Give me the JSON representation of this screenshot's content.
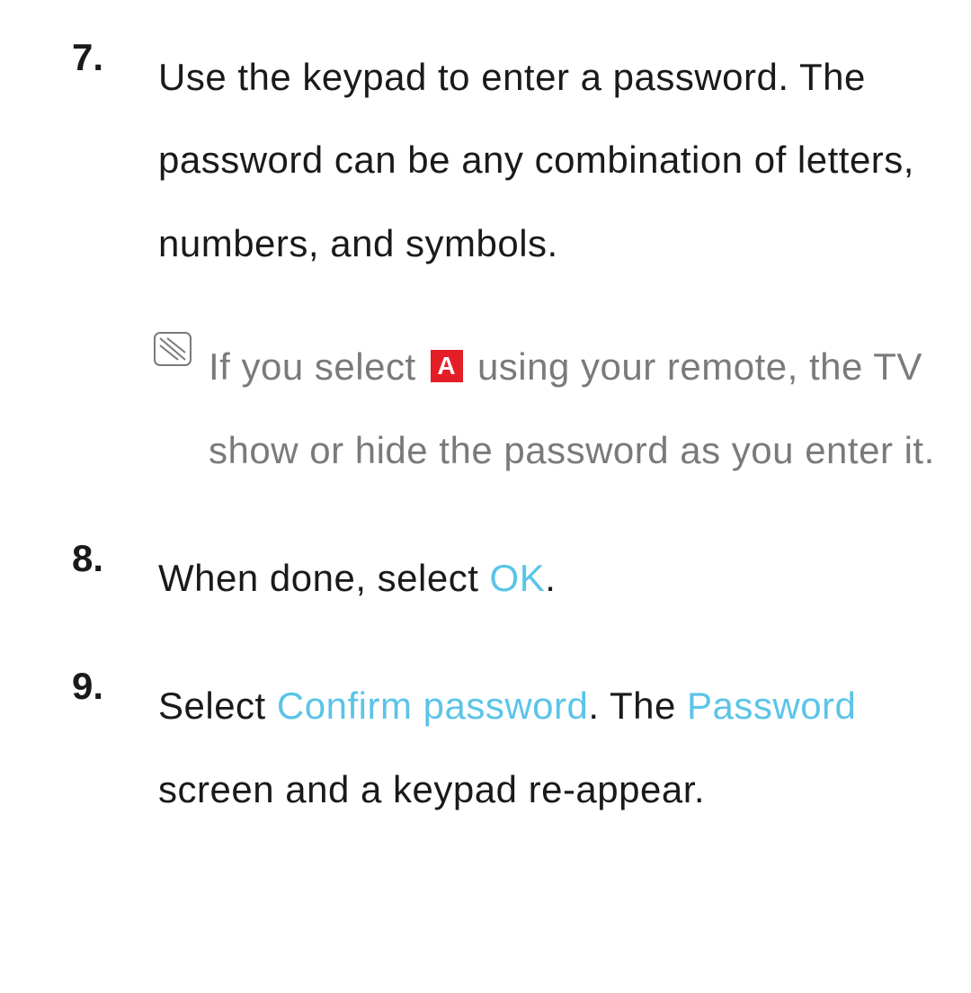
{
  "items": [
    {
      "number": "7.",
      "text": "Use the keypad to enter a password. The password can be any combination of letters, numbers, and symbols.",
      "note": {
        "prefix": "If you select ",
        "badge": "A",
        "suffix": " using your remote, the TV show or hide the password as you enter it."
      }
    },
    {
      "number": "8.",
      "prefix": "When done, select ",
      "link1": "OK",
      "suffix1": "."
    },
    {
      "number": "9.",
      "prefix": "Select ",
      "link1": "Confirm password",
      "mid1": ". The ",
      "link2": "Password",
      "suffix1": " screen and a keypad re-appear."
    }
  ]
}
